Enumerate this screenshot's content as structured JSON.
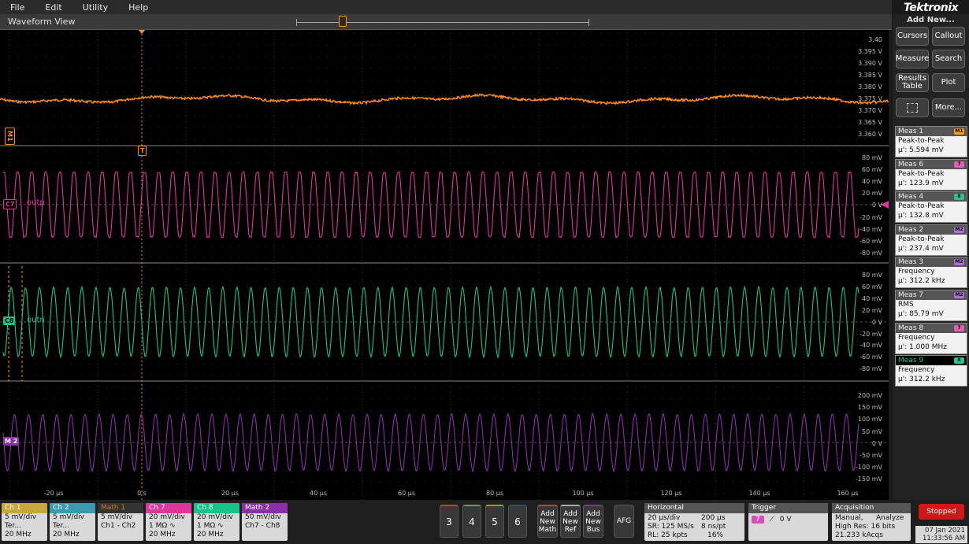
{
  "menu": [
    "File",
    "Edit",
    "Utility",
    "Help"
  ],
  "brand": "Tektronix",
  "waveform_view": {
    "title": "Waveform View"
  },
  "trigger_marker": "T",
  "y_labels_top": [
    "3.40",
    "3.395 V",
    "3.390 V",
    "3.385 V",
    "3.380 V",
    "3.375 V",
    "3.370 V",
    "3.365 V",
    "3.360 V"
  ],
  "y_labels_c7": [
    "80 mV",
    "60 mV",
    "40 mV",
    "20 mV",
    "0 V",
    "-20 mV",
    "-40 mV",
    "-60 mV",
    "-80 mV"
  ],
  "y_labels_c8": [
    "80 mV",
    "60 mV",
    "40 mV",
    "20 mV",
    "0 V",
    "-20 mV",
    "-40 mV",
    "-60 mV",
    "-80 mV"
  ],
  "y_labels_m2": [
    "200 mV",
    "150 mV",
    "100 mV",
    "50 mV",
    "0 V",
    "-50 mV",
    "-100 mV",
    "-150 mV"
  ],
  "x_labels": [
    "-20 µs",
    "0 s",
    "20 µs",
    "40 µs",
    "60 µs",
    "80 µs",
    "100 µs",
    "120 µs",
    "140 µs",
    "160 µs"
  ],
  "trace_tags": {
    "m1": "M1",
    "c7": "C7",
    "c8": "C8",
    "m2": "M 2"
  },
  "trace_names": {
    "c7": "outp",
    "c8": "outn"
  },
  "colors": {
    "m1": "#ff8c1a",
    "c7": "#e0359a",
    "c8": "#16c48a",
    "m2": "#8a2fa8",
    "ch1": "#c8a838",
    "ch2": "#3a9ab0"
  },
  "right_panel": {
    "add_new": "Add New...",
    "buttons": [
      "Cursors",
      "Callout",
      "Measure",
      "Search",
      "Results Table",
      "Plot",
      "More..."
    ],
    "measurements": [
      {
        "name": "Meas 1",
        "badge": "M1",
        "type": "Peak-to-Peak",
        "value": "µ': 5.594 mV"
      },
      {
        "name": "Meas 6",
        "badge": "7",
        "type": "Peak-to-Peak",
        "value": "µ': 123.9 mV"
      },
      {
        "name": "Meas 4",
        "badge": "8",
        "type": "Peak-to-Peak",
        "value": "µ': 132.8 mV"
      },
      {
        "name": "Meas 2",
        "badge": "M2",
        "type": "Peak-to-Peak",
        "value": "µ': 237.4 mV"
      },
      {
        "name": "Meas 3",
        "badge": "M2",
        "type": "Frequency",
        "value": "µ': 312.2 kHz"
      },
      {
        "name": "Meas 7",
        "badge": "M2",
        "type": "RMS",
        "value": "µ': 85.79 mV"
      },
      {
        "name": "Meas 8",
        "badge": "7",
        "type": "Frequency",
        "value": "µ': 1.000 MHz"
      },
      {
        "name": "Meas 9",
        "badge": "8",
        "type": "Frequency",
        "value": "µ': 312.2 kHz"
      }
    ]
  },
  "channels": [
    {
      "head": "Ch 1",
      "l1": "5 mV/div",
      "l2": "Ter...",
      "l3": "20 MHz"
    },
    {
      "head": "Ch 2",
      "l1": "5 mV/div",
      "l2": "Ter...",
      "l3": "20 MHz"
    },
    {
      "head": "Math 1",
      "l1": "5 mV/div",
      "l2": "Ch1 - Ch2",
      "l3": ""
    },
    {
      "head": "Ch 7",
      "l1": "20 mV/div",
      "l2": "1 MΩ ∿",
      "l3": "20 MHz"
    },
    {
      "head": "Ch 8",
      "l1": "20 mV/div",
      "l2": "1 MΩ ∿",
      "l3": "20 MHz"
    },
    {
      "head": "Math 2",
      "l1": "50 mV/div",
      "l2": "Ch7 - Ch8",
      "l3": ""
    }
  ],
  "channel_buttons": [
    "3",
    "4",
    "5",
    "6"
  ],
  "add_buttons": [
    "Add New Math",
    "Add New Ref",
    "Add New Bus"
  ],
  "afg": "AFG",
  "horizontal": {
    "title": "Horizontal",
    "scale": "20 µs/div",
    "pos": "200 µs",
    "sr": "SR: 125 MS/s",
    "pt": "8 ns/pt",
    "rl": "RL: 25 kpts",
    "pct": "16%"
  },
  "trigger": {
    "title": "Trigger",
    "src": "7",
    "level": "0 V"
  },
  "acquisition": {
    "title": "Acquisition",
    "mode": "Manual,",
    "analyze": "Analyze",
    "res": "High Res: 16 bits",
    "acqs": "21.233 kAcqs"
  },
  "status": {
    "stopped": "Stopped",
    "date": "07 Jan 2021",
    "time": "11:33:56 AM"
  }
}
